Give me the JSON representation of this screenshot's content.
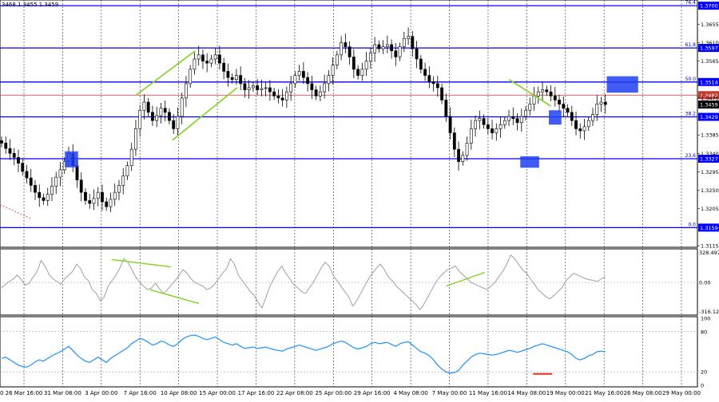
{
  "header": {
    "ohlc_text": "3468 1.3455 1.3459"
  },
  "colors": {
    "candle": "#000000",
    "fib_line": "#0000ff",
    "price_line": "#c0392b",
    "highlight_box": "#1f3ff0",
    "divergence": "#7ed321",
    "cci_line": "#a0a0a0",
    "rsi_line": "#1e90ff",
    "rsi_marker": "#e03020",
    "grid": "#000000"
  },
  "chart_data": [
    {
      "type": "candlestick",
      "instrument_text": "GBP/USD",
      "ylim": [
        1.3115,
        1.371
      ],
      "y_ticks": [
        "1.3655",
        "1.3610",
        "1.3565",
        "1.3475",
        "1.3385",
        "1.3340",
        "1.3295",
        "1.3250",
        "1.3205",
        "1.3115"
      ],
      "x_ticks": [
        "26 Mar 16:00",
        "31 Mar 08:00",
        "3 Apr 00:00",
        "7 Apr 16:00",
        "10 Apr 08:00",
        "15 Apr 00:00",
        "17 Apr 16:00",
        "22 Apr 08:00",
        "25 Apr 00:00",
        "29 Apr 16:00",
        "4 May 08:00",
        "7 May 00:00",
        "11 May 16:00",
        "14 May 08:00",
        "19 May 00:00",
        "21 May 16:00",
        "26 May 08:00",
        "29 May 00:00"
      ],
      "x_tick_left_fragment": "0",
      "fib_levels": [
        {
          "ratio": "76.4",
          "price": 1.37,
          "label": "1.3700"
        },
        {
          "ratio": "61.8",
          "price": 1.3597,
          "label": "1.3597"
        },
        {
          "ratio": "50.0",
          "price": 1.3514,
          "label": "1.3514"
        },
        {
          "ratio": "38.2",
          "price": 1.3429,
          "label": "1.3429"
        },
        {
          "ratio": "23.6",
          "price": 1.3327,
          "label": "1.3327"
        },
        {
          "ratio": "0.0",
          "price": 1.3159,
          "label": "1.3159"
        }
      ],
      "price_lines": [
        {
          "price": 1.3482,
          "label": "1.3482"
        },
        {
          "price": 1.3459,
          "label": "1.3459"
        }
      ],
      "closes": [
        1.3365,
        1.3352,
        1.334,
        1.333,
        1.3316,
        1.3296,
        1.328,
        1.3262,
        1.3245,
        1.3232,
        1.3225,
        1.324,
        1.326,
        1.3282,
        1.33,
        1.332,
        1.334,
        1.331,
        1.3275,
        1.3245,
        1.3225,
        1.3218,
        1.323,
        1.3245,
        1.3222,
        1.321,
        1.3228,
        1.3245,
        1.3262,
        1.3285,
        1.331,
        1.335,
        1.34,
        1.3445,
        1.3465,
        1.344,
        1.342,
        1.3432,
        1.345,
        1.344,
        1.342,
        1.34,
        1.343,
        1.3475,
        1.351,
        1.3545,
        1.357,
        1.358,
        1.3565,
        1.356,
        1.357,
        1.358,
        1.356,
        1.354,
        1.3525,
        1.352,
        1.353,
        1.351,
        1.3495,
        1.35,
        1.3505,
        1.3495,
        1.3498,
        1.35,
        1.349,
        1.348,
        1.3475,
        1.347,
        1.349,
        1.351,
        1.353,
        1.354,
        1.3525,
        1.351,
        1.3495,
        1.348,
        1.349,
        1.351,
        1.353,
        1.3555,
        1.358,
        1.361,
        1.36,
        1.3575,
        1.3545,
        1.353,
        1.3545,
        1.3565,
        1.3585,
        1.3605,
        1.3595,
        1.36,
        1.3605,
        1.359,
        1.3575,
        1.36,
        1.362,
        1.3625,
        1.3595,
        1.357,
        1.3545,
        1.353,
        1.3515,
        1.351,
        1.35,
        1.347,
        1.343,
        1.339,
        1.335,
        1.332,
        1.3335,
        1.3365,
        1.34,
        1.342,
        1.3425,
        1.341,
        1.34,
        1.339,
        1.34,
        1.341,
        1.342,
        1.343,
        1.3425,
        1.3415,
        1.343,
        1.3445,
        1.346,
        1.348,
        1.349,
        1.3495,
        1.349,
        1.348,
        1.347,
        1.346,
        1.345,
        1.344,
        1.342,
        1.34,
        1.3395,
        1.3405,
        1.342,
        1.3435,
        1.346,
        1.3465,
        1.3459
      ],
      "highlight_zones": [
        {
          "x_from": 0.093,
          "x_to": 0.112,
          "y_high": 1.3345,
          "y_low": 1.3306
        },
        {
          "x_from": 0.787,
          "x_to": 0.805,
          "y_high": 1.3445,
          "y_low": 1.341
        },
        {
          "x_from": 0.746,
          "x_to": 0.773,
          "y_high": 1.3333,
          "y_low": 1.3305
        },
        {
          "x_from": 0.87,
          "x_to": 0.915,
          "y_high": 1.3528,
          "y_low": 1.3488
        }
      ],
      "trend_lines": [
        {
          "x1": 0.195,
          "y1": 1.3482,
          "x2": 0.28,
          "y2": 1.359
        },
        {
          "x1": 0.247,
          "y1": 1.3372,
          "x2": 0.34,
          "y2": 1.35
        },
        {
          "x1": 0.73,
          "y1": 1.352,
          "x2": 0.79,
          "y2": 1.3455
        }
      ]
    },
    {
      "type": "line",
      "indicator": "cci",
      "ylim": [
        -340,
        350
      ],
      "y_ticks": [
        "328.4976",
        "0.00",
        "-316.1271"
      ],
      "series": [
        {
          "values": [
            -60,
            -20,
            10,
            40,
            80,
            30,
            -30,
            -10,
            60,
            120,
            240,
            180,
            90,
            40,
            10,
            -20,
            40,
            80,
            120,
            200,
            150,
            60,
            20,
            -80,
            -120,
            -200,
            -160,
            -40,
            20,
            80,
            160,
            260,
            220,
            140,
            60,
            0,
            -40,
            -80,
            -60,
            -10,
            -70,
            -120,
            -80,
            -30,
            20,
            80,
            140,
            100,
            40,
            0,
            -20,
            -40,
            -80,
            -60,
            -20,
            40,
            100,
            150,
            260,
            200,
            80,
            20,
            -40,
            -100,
            -140,
            -220,
            -280,
            -160,
            -40,
            40,
            120,
            180,
            100,
            40,
            -20,
            -60,
            -100,
            -120,
            -60,
            0,
            80,
            160,
            220,
            180,
            80,
            20,
            -40,
            -100,
            -160,
            -260,
            -200,
            -120,
            -40,
            40,
            100,
            160,
            200,
            140,
            60,
            20,
            -40,
            -80,
            -120,
            -160,
            -200,
            -240,
            -300,
            -240,
            -160,
            -80,
            0,
            60,
            100,
            140,
            160,
            180,
            120,
            80,
            40,
            0,
            -20,
            -40,
            -60,
            -80,
            -40,
            0,
            60,
            120,
            200,
            300,
            260,
            200,
            140,
            100,
            40,
            -20,
            -80,
            -120,
            -160,
            -180,
            -140,
            -100,
            -60,
            20,
            60,
            100,
            80,
            60,
            40,
            30,
            20,
            10,
            40,
            60
          ]
        }
      ]
    },
    {
      "type": "line",
      "indicator": "rsi",
      "ylim": [
        0,
        100
      ],
      "y_ticks": [
        "100",
        "80",
        "20",
        "0"
      ],
      "marker": {
        "x": 0.778,
        "value": 17
      },
      "series": [
        {
          "values": [
            40,
            42,
            38,
            34,
            30,
            28,
            27,
            30,
            35,
            38,
            36,
            40,
            44,
            47,
            50,
            54,
            58,
            52,
            45,
            40,
            36,
            34,
            38,
            42,
            38,
            34,
            40,
            44,
            48,
            52,
            56,
            62,
            66,
            70,
            68,
            64,
            60,
            62,
            66,
            64,
            60,
            58,
            62,
            68,
            72,
            74,
            75,
            73,
            70,
            68,
            70,
            72,
            68,
            64,
            62,
            60,
            62,
            58,
            55,
            56,
            57,
            55,
            56,
            57,
            55,
            53,
            52,
            51,
            54,
            56,
            58,
            60,
            58,
            56,
            54,
            52,
            54,
            56,
            58,
            62,
            64,
            66,
            64,
            60,
            56,
            54,
            56,
            58,
            62,
            64,
            62,
            63,
            64,
            61,
            58,
            62,
            64,
            65,
            60,
            55,
            50,
            48,
            44,
            38,
            30,
            24,
            20,
            18,
            19,
            22,
            30,
            36,
            42,
            46,
            48,
            47,
            46,
            45,
            46,
            48,
            50,
            52,
            51,
            49,
            51,
            53,
            55,
            58,
            60,
            62,
            60,
            58,
            56,
            54,
            52,
            50,
            46,
            40,
            38,
            40,
            44,
            46,
            50,
            51,
            50
          ]
        }
      ]
    }
  ]
}
